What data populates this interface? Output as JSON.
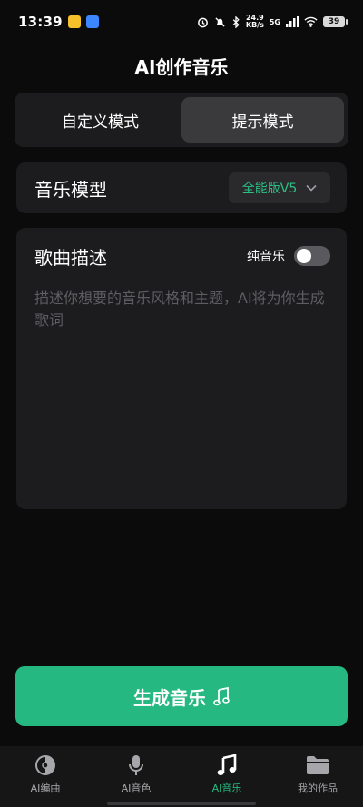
{
  "status_bar": {
    "time": "13:39",
    "net_speed_value": "24.9",
    "net_speed_unit": "KB/s",
    "network_type": "5G",
    "battery": "39"
  },
  "header": {
    "title": "AI创作音乐"
  },
  "mode_tabs": [
    {
      "label": "自定义模式",
      "active": false
    },
    {
      "label": "提示模式",
      "active": true
    }
  ],
  "model": {
    "label": "音乐模型",
    "selected": "全能版V5",
    "chevron_icon": "chevron-down-icon"
  },
  "description": {
    "label": "歌曲描述",
    "pure_music_label": "纯音乐",
    "pure_music_on": false,
    "placeholder": "描述你想要的音乐风格和主题，AI将为你生成歌词"
  },
  "generate": {
    "label": "生成音乐",
    "icon": "music-note-icon"
  },
  "bottom_nav": [
    {
      "label": "AI编曲",
      "icon": "disc-icon",
      "active": false
    },
    {
      "label": "AI音色",
      "icon": "microphone-icon",
      "active": false
    },
    {
      "label": "AI音乐",
      "icon": "music-note-icon",
      "active": true
    },
    {
      "label": "我的作品",
      "icon": "folder-icon",
      "active": false
    }
  ],
  "colors": {
    "accent": "#25b981",
    "background": "#0b0b0c",
    "card": "#1c1c1e"
  }
}
